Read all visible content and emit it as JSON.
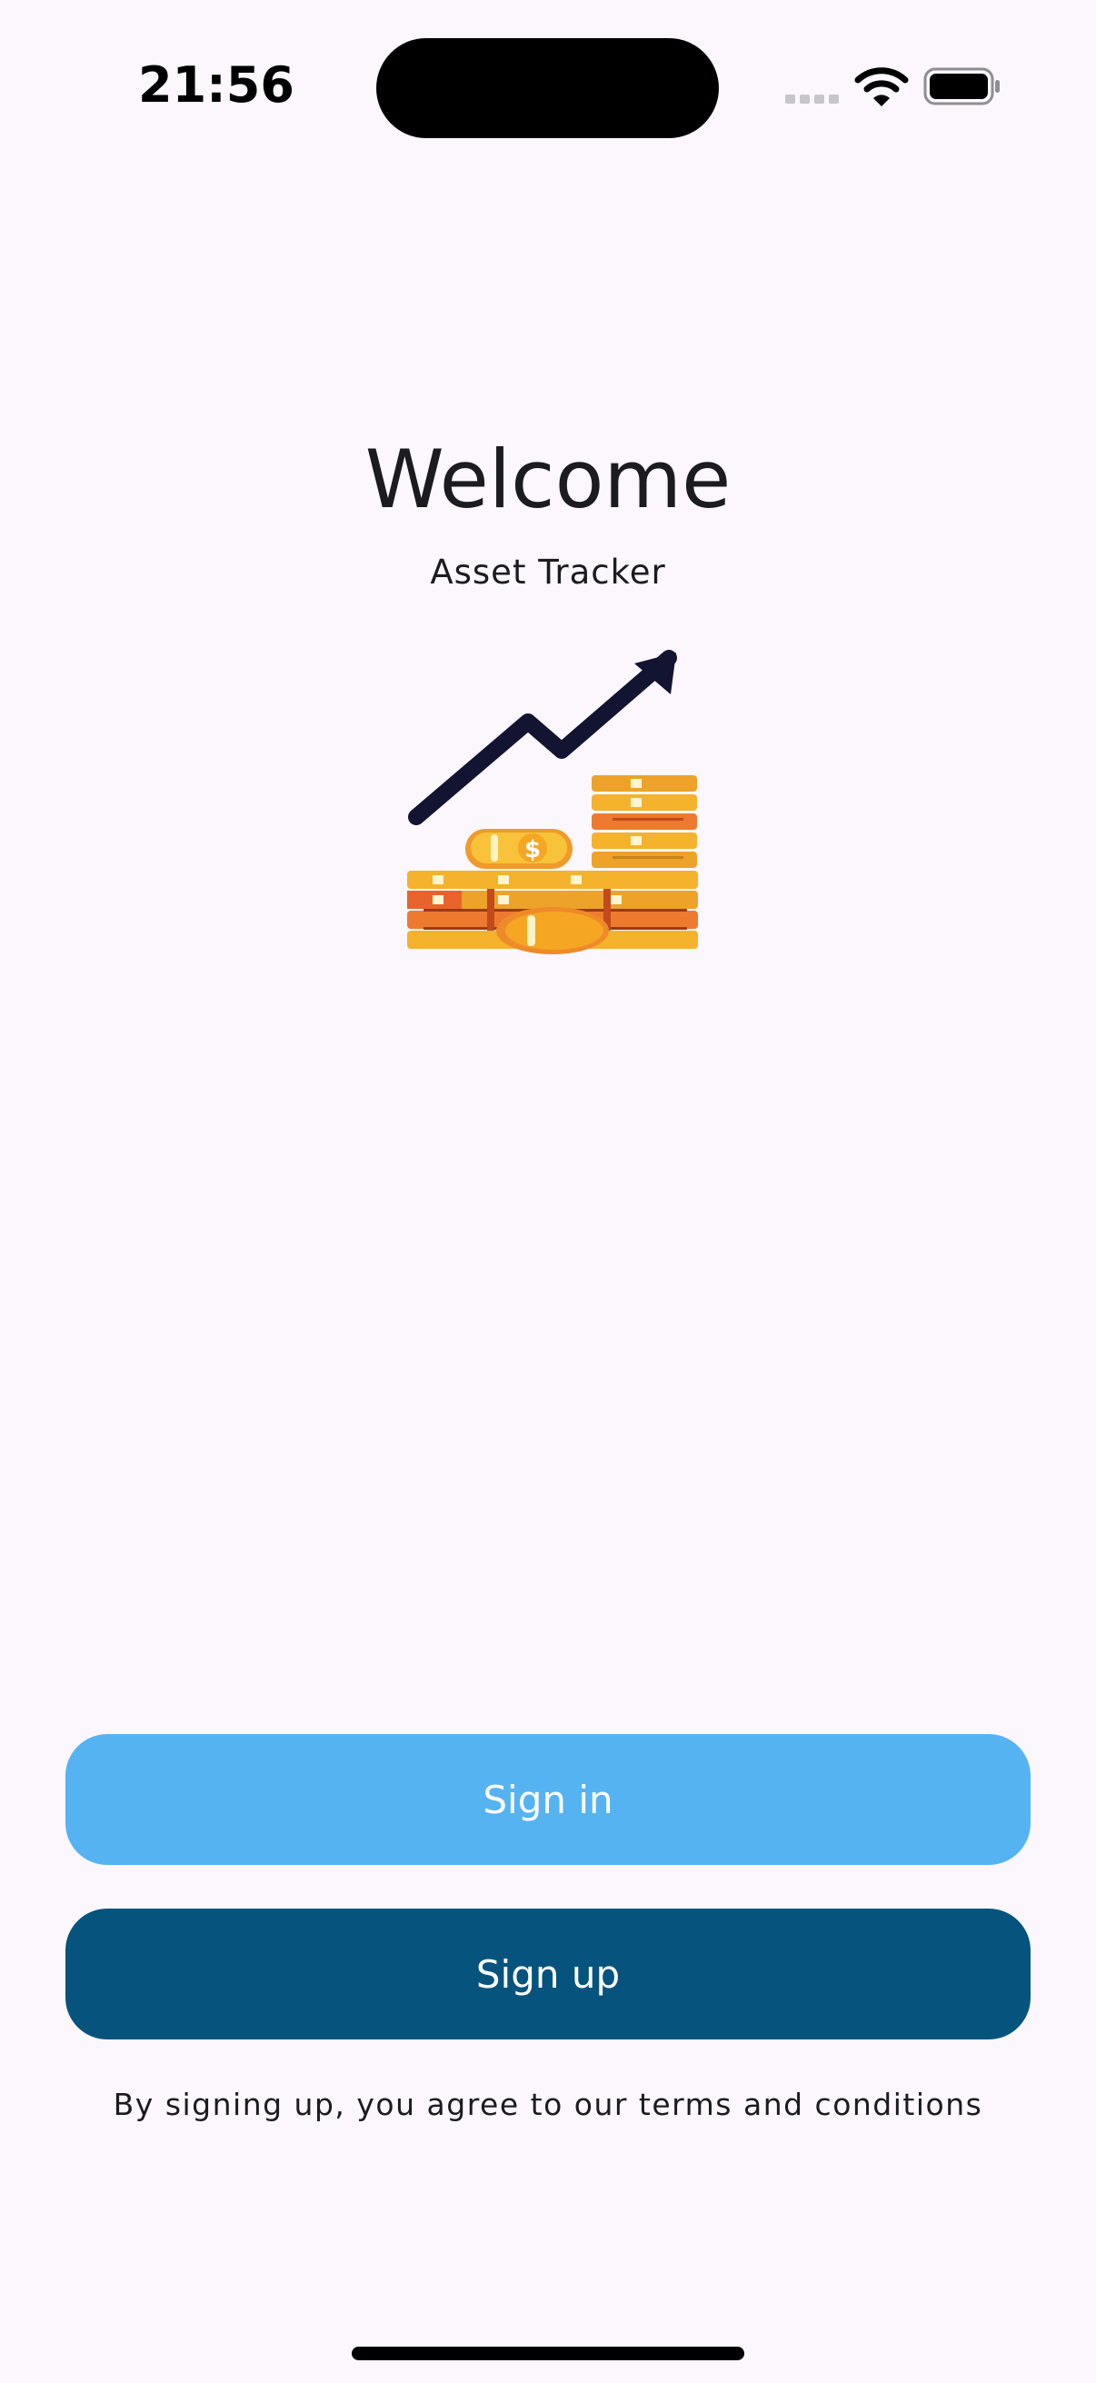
{
  "status_bar": {
    "time": "21:56",
    "icons": [
      "cellular-signal-icon",
      "wifi-icon",
      "battery-icon"
    ]
  },
  "welcome": {
    "title": "Welcome",
    "subtitle": "Asset Tracker",
    "illustration": "growth-coins-illustration"
  },
  "actions": {
    "sign_in_label": "Sign in",
    "sign_up_label": "Sign up",
    "terms": "By signing up, you agree to our terms and conditions"
  },
  "colors": {
    "background": "#fbf7fd",
    "sign_in_button": "#56b3f2",
    "sign_up_button": "#06537e",
    "coin_gold": "#f5b22c",
    "coin_orange": "#ee7a30",
    "arrow": "#131431"
  }
}
